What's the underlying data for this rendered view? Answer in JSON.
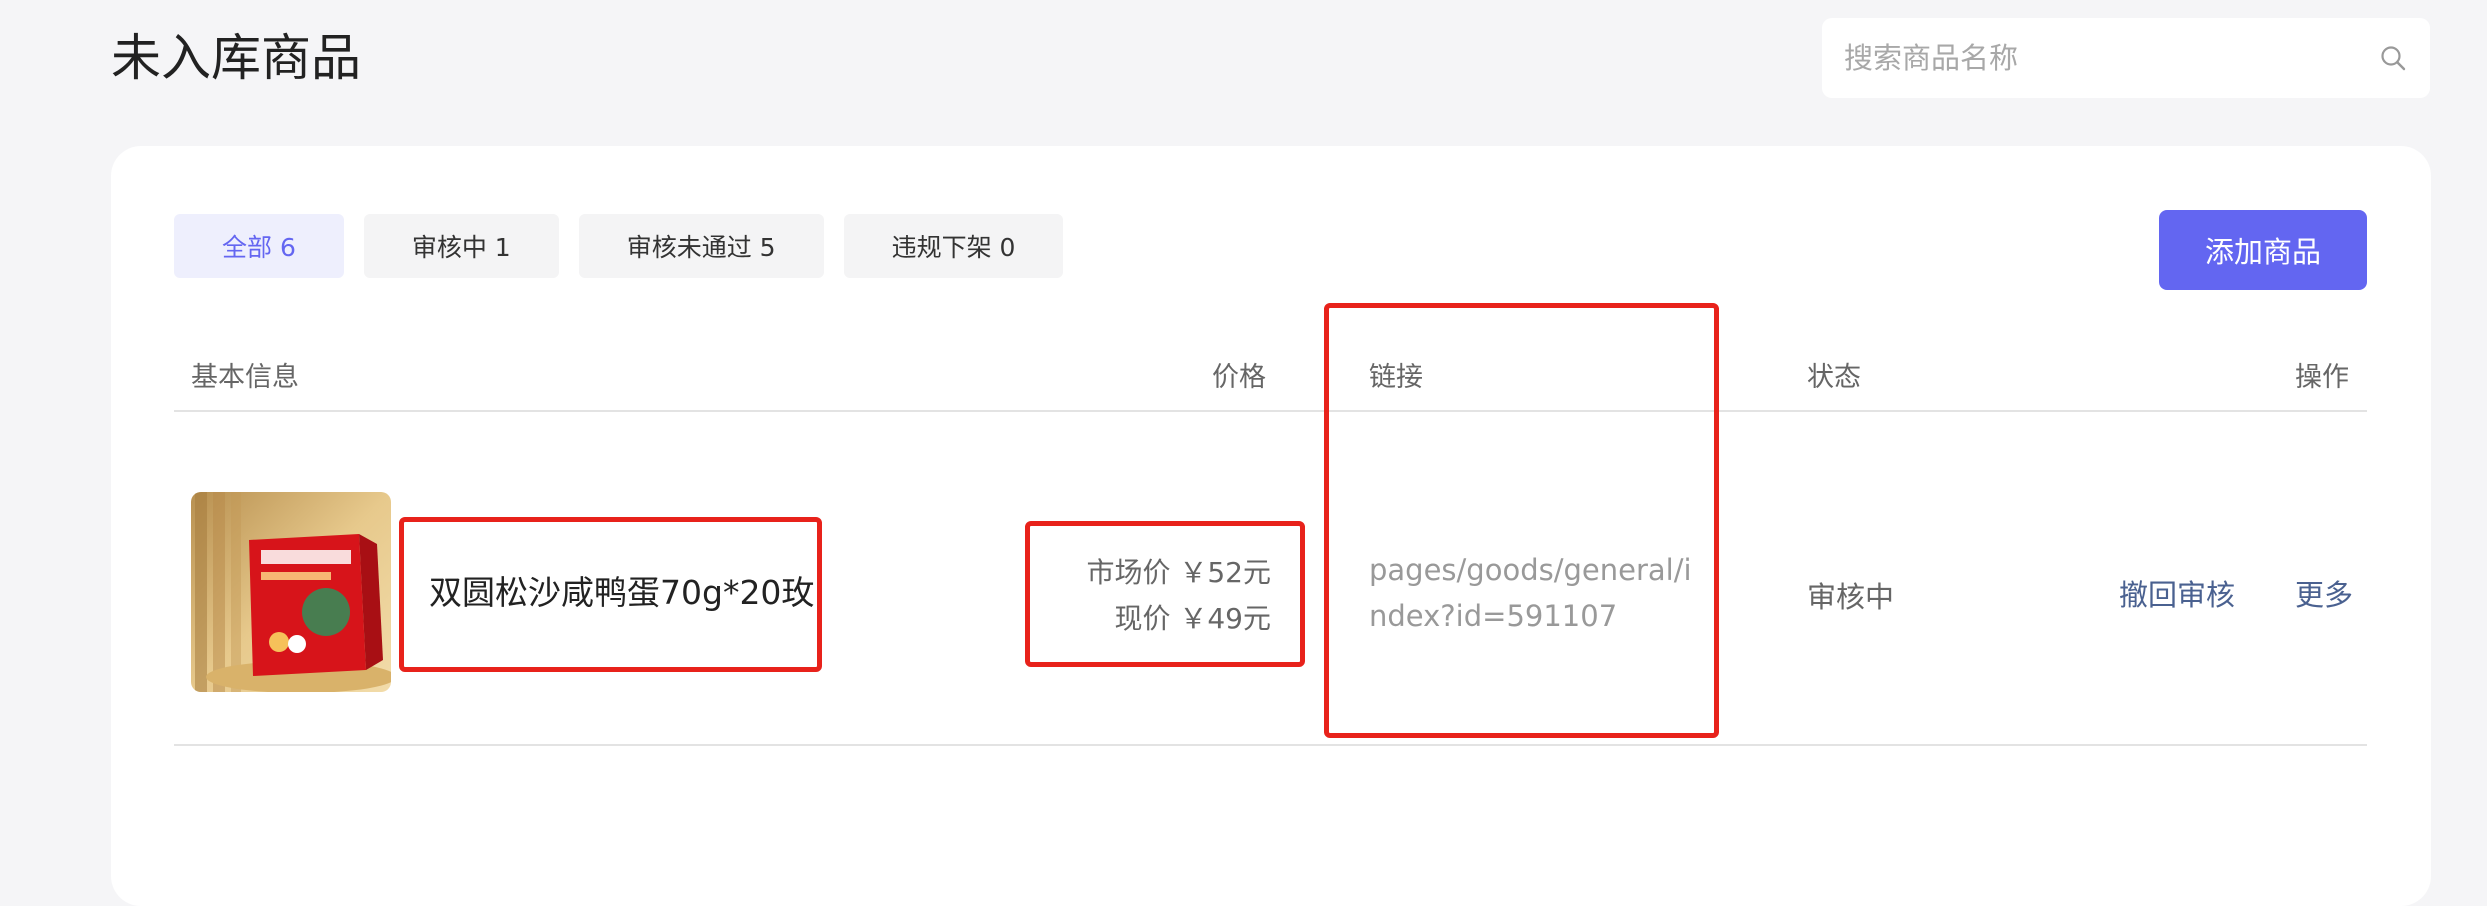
{
  "header": {
    "title": "未入库商品"
  },
  "search": {
    "placeholder": "搜索商品名称",
    "value": ""
  },
  "tabs": [
    {
      "label": "全部 6",
      "active": true
    },
    {
      "label": "审核中 1",
      "active": false
    },
    {
      "label": "审核未通过 5",
      "active": false
    },
    {
      "label": "违规下架 0",
      "active": false
    }
  ],
  "toolbar": {
    "add_label": "添加商品"
  },
  "table": {
    "columns": {
      "basic": "基本信息",
      "price": "价格",
      "link": "链接",
      "status": "状态",
      "ops": "操作"
    },
    "rows": [
      {
        "name": "双圆松沙咸鸭蛋70g*20玫",
        "market_price": "市场价 ￥52元",
        "current_price": "现价 ￥49元",
        "link": "pages/goods/general/index?id=591107",
        "status": "审核中",
        "withdraw_label": "撤回审核",
        "more_label": "更多"
      }
    ]
  },
  "colors": {
    "accent": "#6366f1",
    "highlight": "#e8221b",
    "link": "#4a6190"
  }
}
